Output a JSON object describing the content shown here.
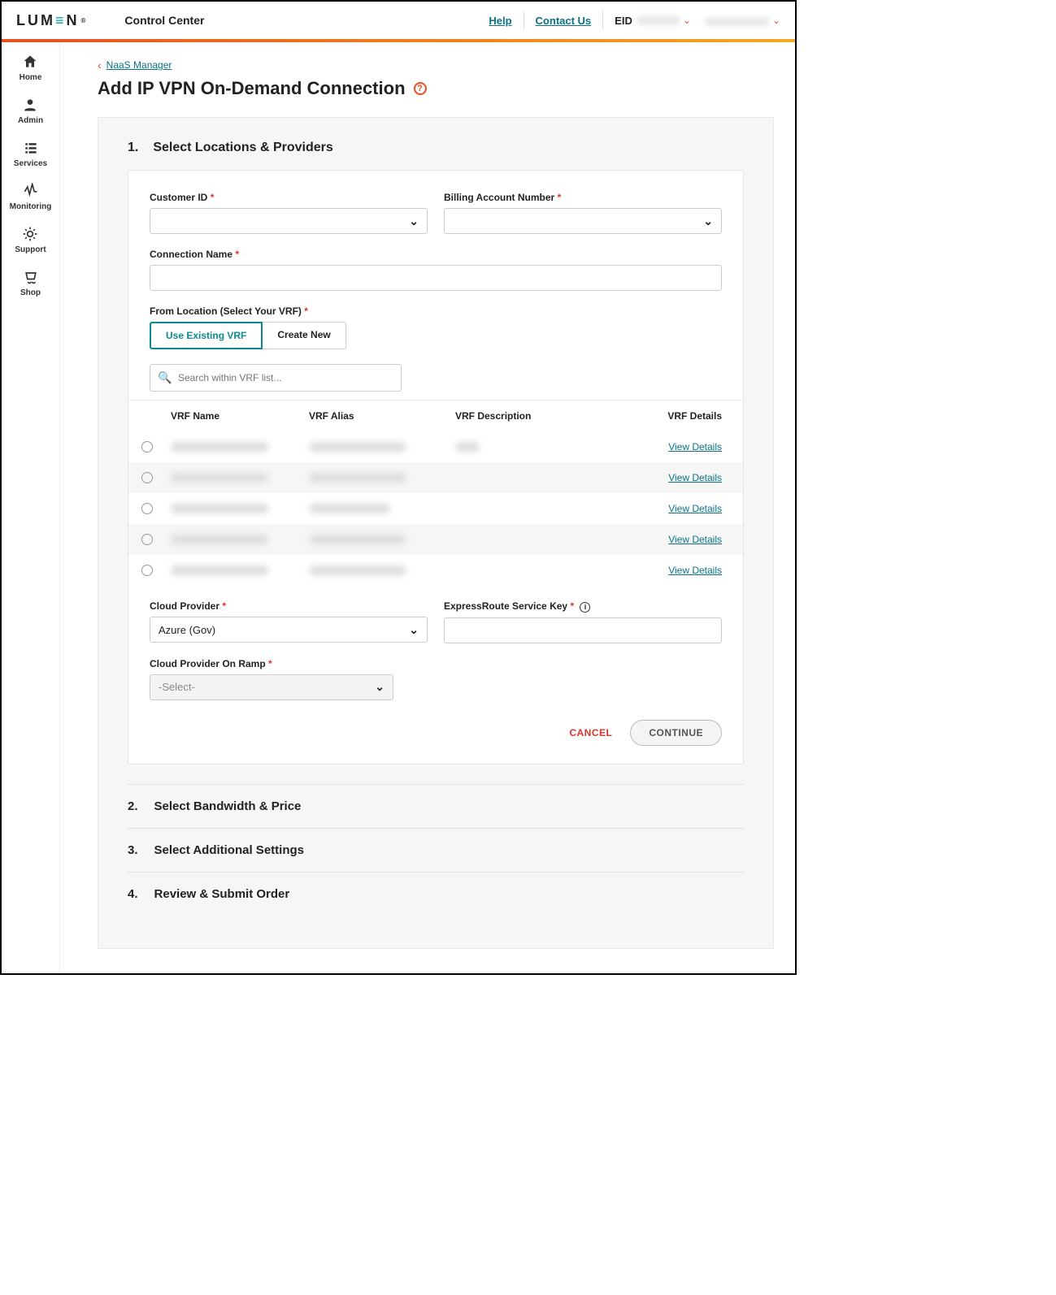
{
  "brand": {
    "logo_text": "LUM≡N",
    "app_title": "Control Center"
  },
  "topbar": {
    "help": "Help",
    "contact": "Contact Us",
    "eid_label": "EID",
    "eid_value": "XXXXXX",
    "username": "xxxxxxxxxxxx"
  },
  "sidebar": [
    {
      "label": "Home"
    },
    {
      "label": "Admin"
    },
    {
      "label": "Services"
    },
    {
      "label": "Monitoring"
    },
    {
      "label": "Support"
    },
    {
      "label": "Shop"
    }
  ],
  "breadcrumb": {
    "back_label": "NaaS Manager"
  },
  "page": {
    "title": "Add IP VPN On-Demand Connection"
  },
  "step1": {
    "num": "1.",
    "title": "Select Locations & Providers",
    "customer_id_label": "Customer ID",
    "customer_id_value": "",
    "ban_label": "Billing Account Number",
    "ban_value": "",
    "conn_name_label": "Connection Name",
    "conn_name_value": "",
    "from_loc_label": "From Location (Select Your VRF)",
    "tab_existing": "Use Existing VRF",
    "tab_create": "Create New",
    "search_placeholder": "Search within VRF list...",
    "col_name": "VRF Name",
    "col_alias": "VRF Alias",
    "col_desc": "VRF Description",
    "col_details": "VRF Details",
    "view_details": "View Details",
    "rows": [
      {
        "name": "",
        "alias": "",
        "desc": ""
      },
      {
        "name": "",
        "alias": "",
        "desc": ""
      },
      {
        "name": "",
        "alias": "",
        "desc": ""
      },
      {
        "name": "",
        "alias": "",
        "desc": ""
      },
      {
        "name": "",
        "alias": "",
        "desc": ""
      }
    ],
    "cloud_provider_label": "Cloud Provider",
    "cloud_provider_value": "Azure (Gov)",
    "er_key_label": "ExpressRoute Service Key",
    "er_key_value": "",
    "on_ramp_label": "Cloud Provider On Ramp",
    "on_ramp_value": "-Select-",
    "cancel": "CANCEL",
    "continue": "CONTINUE"
  },
  "steps_rest": [
    {
      "num": "2.",
      "title": "Select Bandwidth & Price"
    },
    {
      "num": "3.",
      "title": "Select Additional Settings"
    },
    {
      "num": "4.",
      "title": "Review & Submit Order"
    }
  ]
}
